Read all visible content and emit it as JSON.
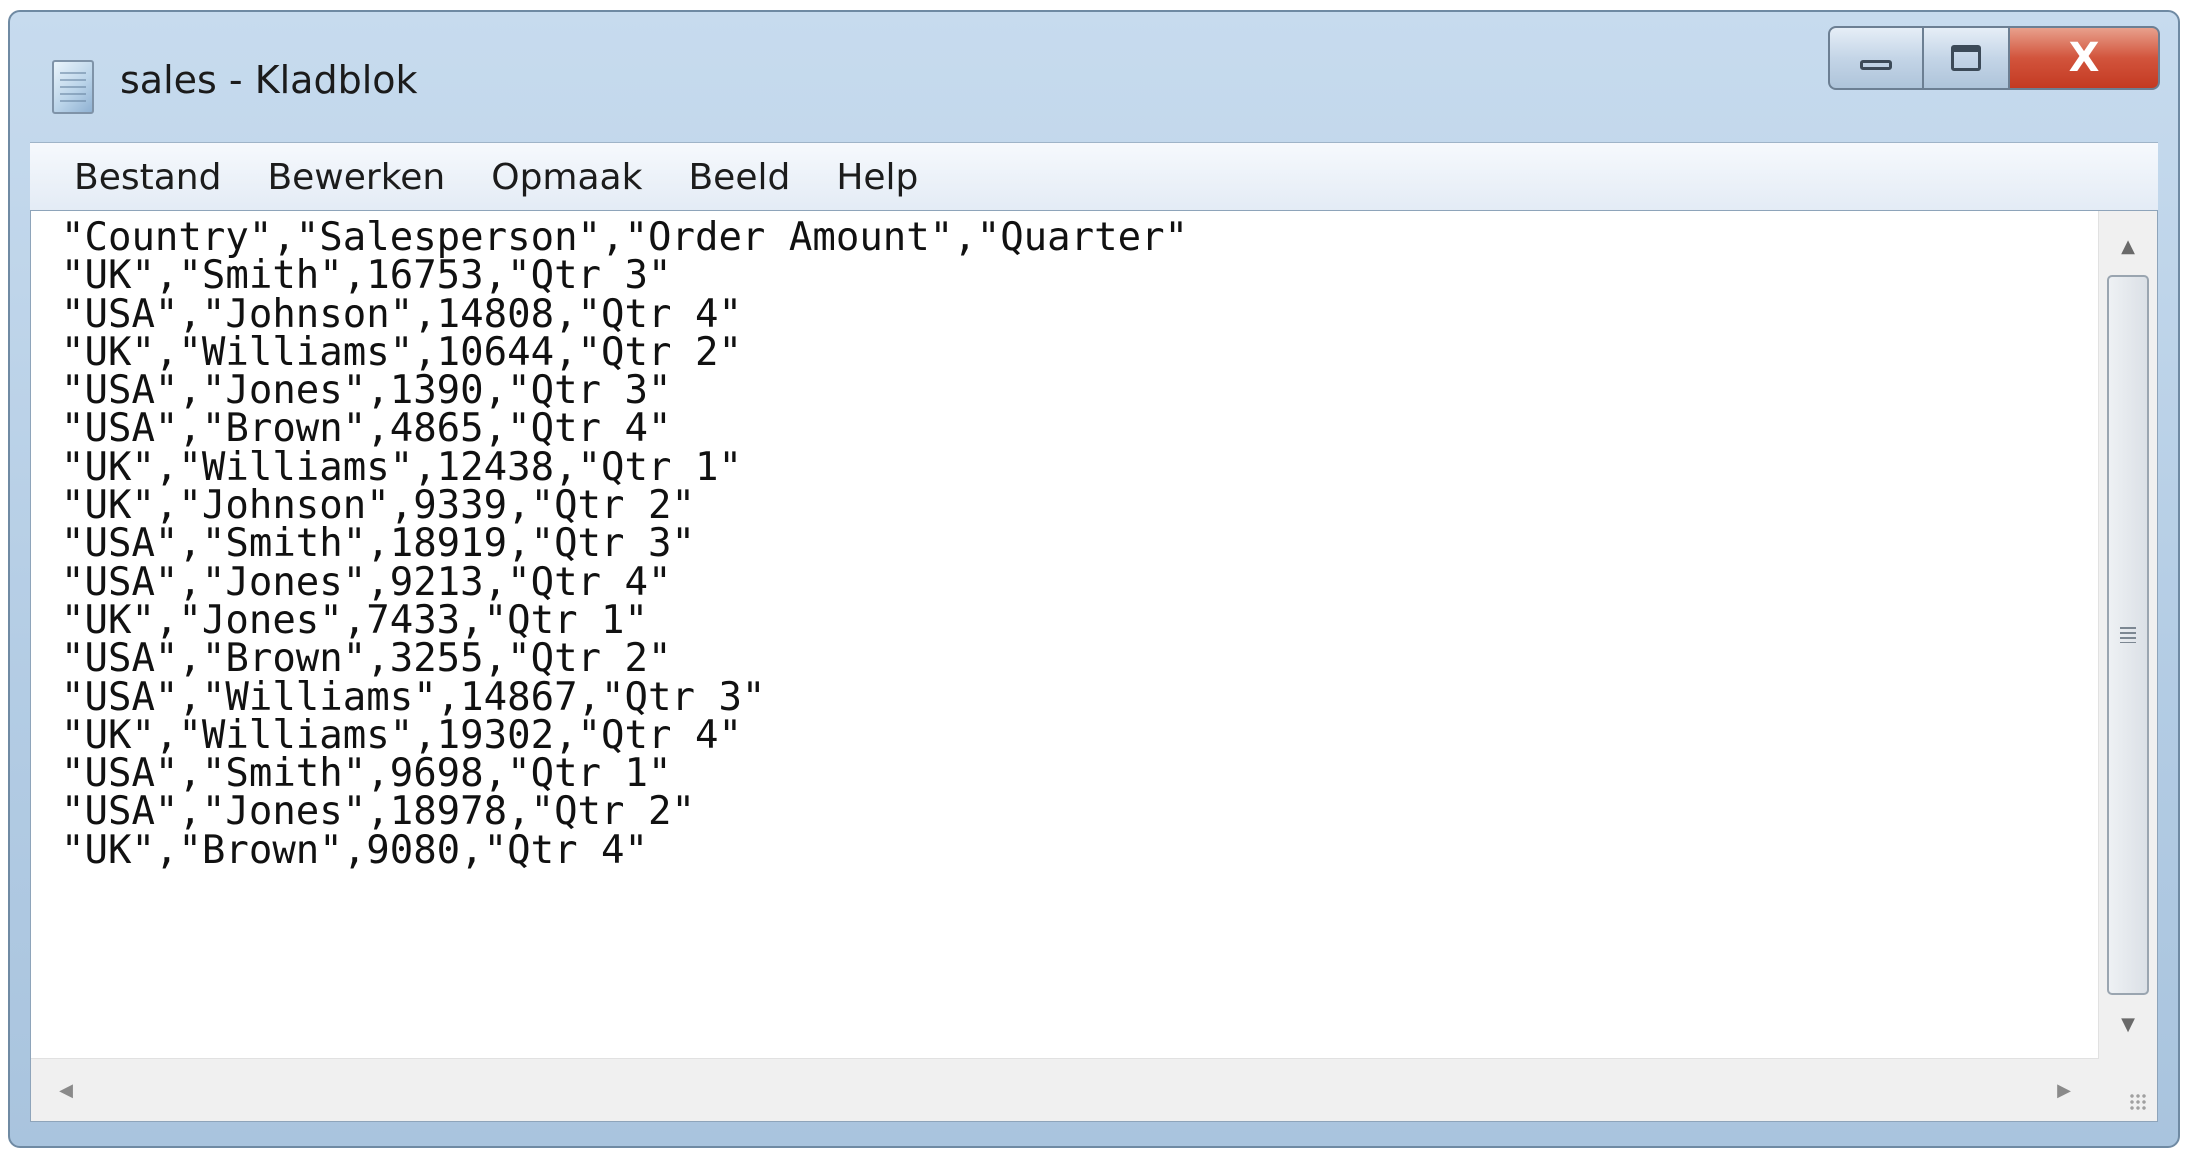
{
  "window": {
    "title": "sales - Kladblok",
    "caption": {
      "minimize_icon": "minimize-icon",
      "maximize_icon": "maximize-icon",
      "close_label": "X"
    }
  },
  "menu": {
    "items": [
      "Bestand",
      "Bewerken",
      "Opmaak",
      "Beeld",
      "Help"
    ]
  },
  "editor": {
    "lines": [
      "\"Country\",\"Salesperson\",\"Order Amount\",\"Quarter\"",
      "\"UK\",\"Smith\",16753,\"Qtr 3\"",
      "\"USA\",\"Johnson\",14808,\"Qtr 4\"",
      "\"UK\",\"Williams\",10644,\"Qtr 2\"",
      "\"USA\",\"Jones\",1390,\"Qtr 3\"",
      "\"USA\",\"Brown\",4865,\"Qtr 4\"",
      "\"UK\",\"Williams\",12438,\"Qtr 1\"",
      "\"UK\",\"Johnson\",9339,\"Qtr 2\"",
      "\"USA\",\"Smith\",18919,\"Qtr 3\"",
      "\"USA\",\"Jones\",9213,\"Qtr 4\"",
      "\"UK\",\"Jones\",7433,\"Qtr 1\"",
      "\"USA\",\"Brown\",3255,\"Qtr 2\"",
      "\"USA\",\"Williams\",14867,\"Qtr 3\"",
      "\"UK\",\"Williams\",19302,\"Qtr 4\"",
      "\"USA\",\"Smith\",9698,\"Qtr 1\"",
      "\"USA\",\"Jones\",18978,\"Qtr 2\"",
      "\"UK\",\"Brown\",9080,\"Qtr 4\""
    ]
  },
  "colors": {
    "frame": "#b3cce4",
    "close_button": "#d2543c",
    "menu_background": "#e3ebf5",
    "text": "#111111"
  }
}
